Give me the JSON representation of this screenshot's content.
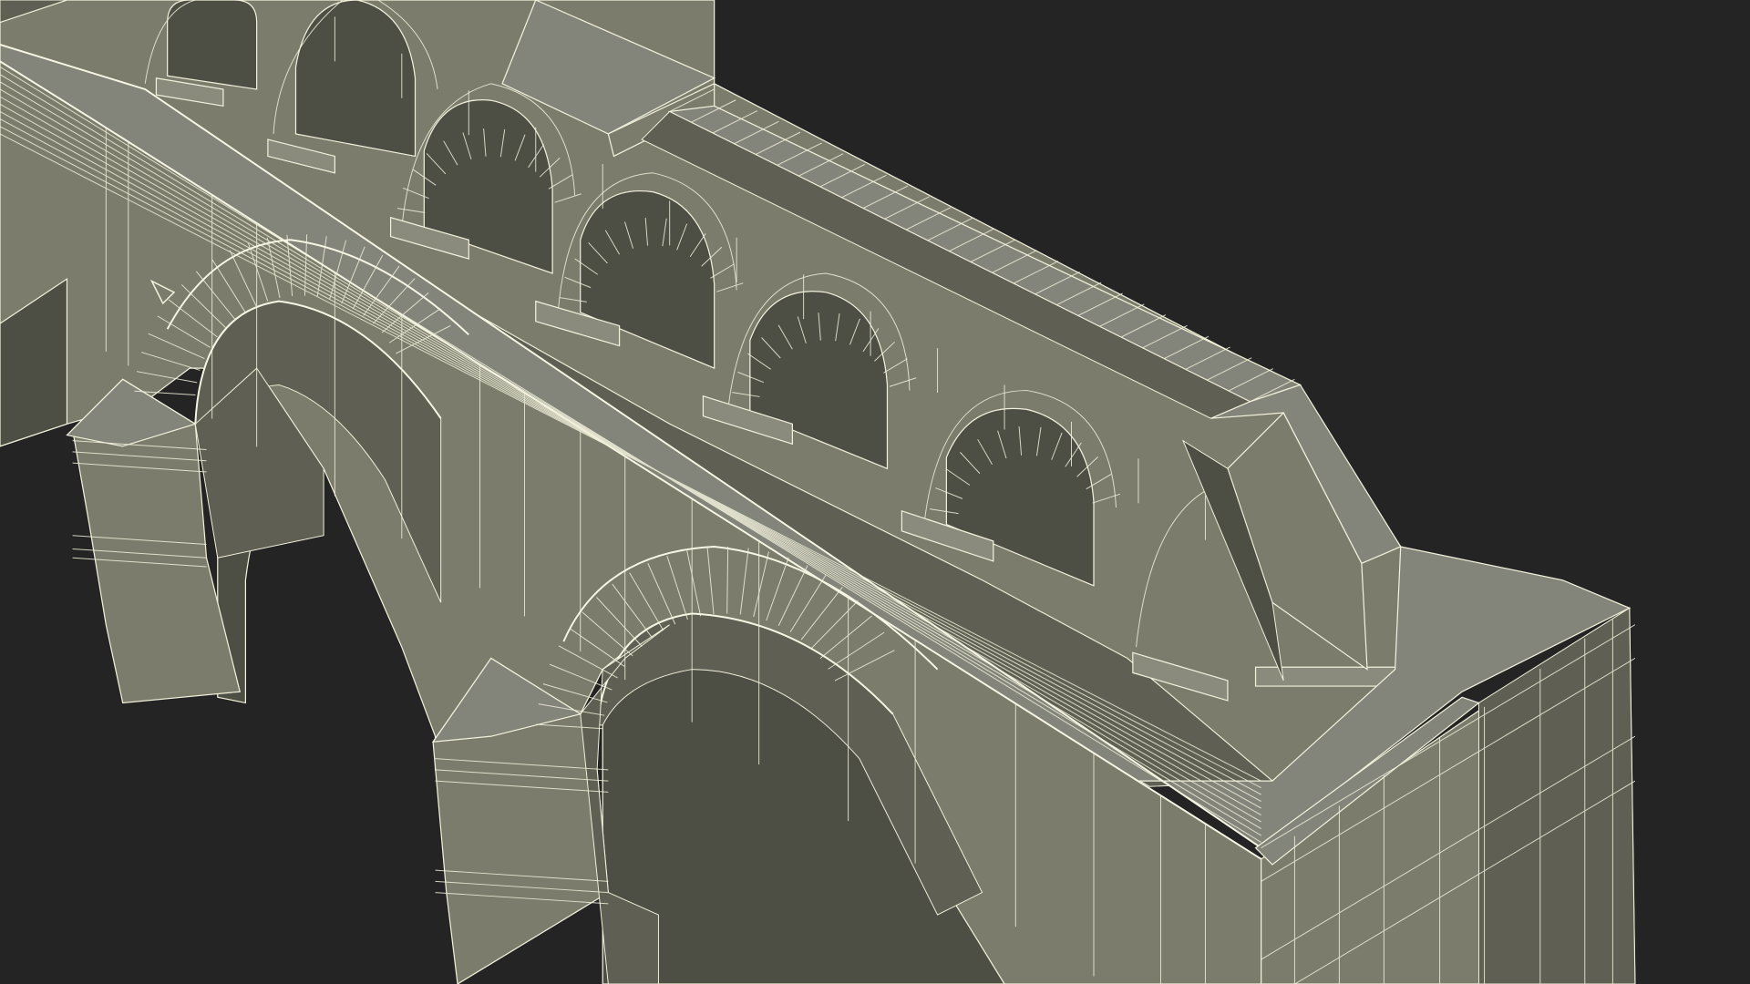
{
  "viewport": {
    "background": "#242424",
    "mode": "wireframe-on-shaded"
  },
  "model": {
    "subject": "aqueduct-bridge-segment",
    "surface_color": "#7b7c6c",
    "surface_shadow_color": "#5c5d50",
    "surface_dark_color": "#4e4f44",
    "wire_color": "#f2f1dc"
  }
}
